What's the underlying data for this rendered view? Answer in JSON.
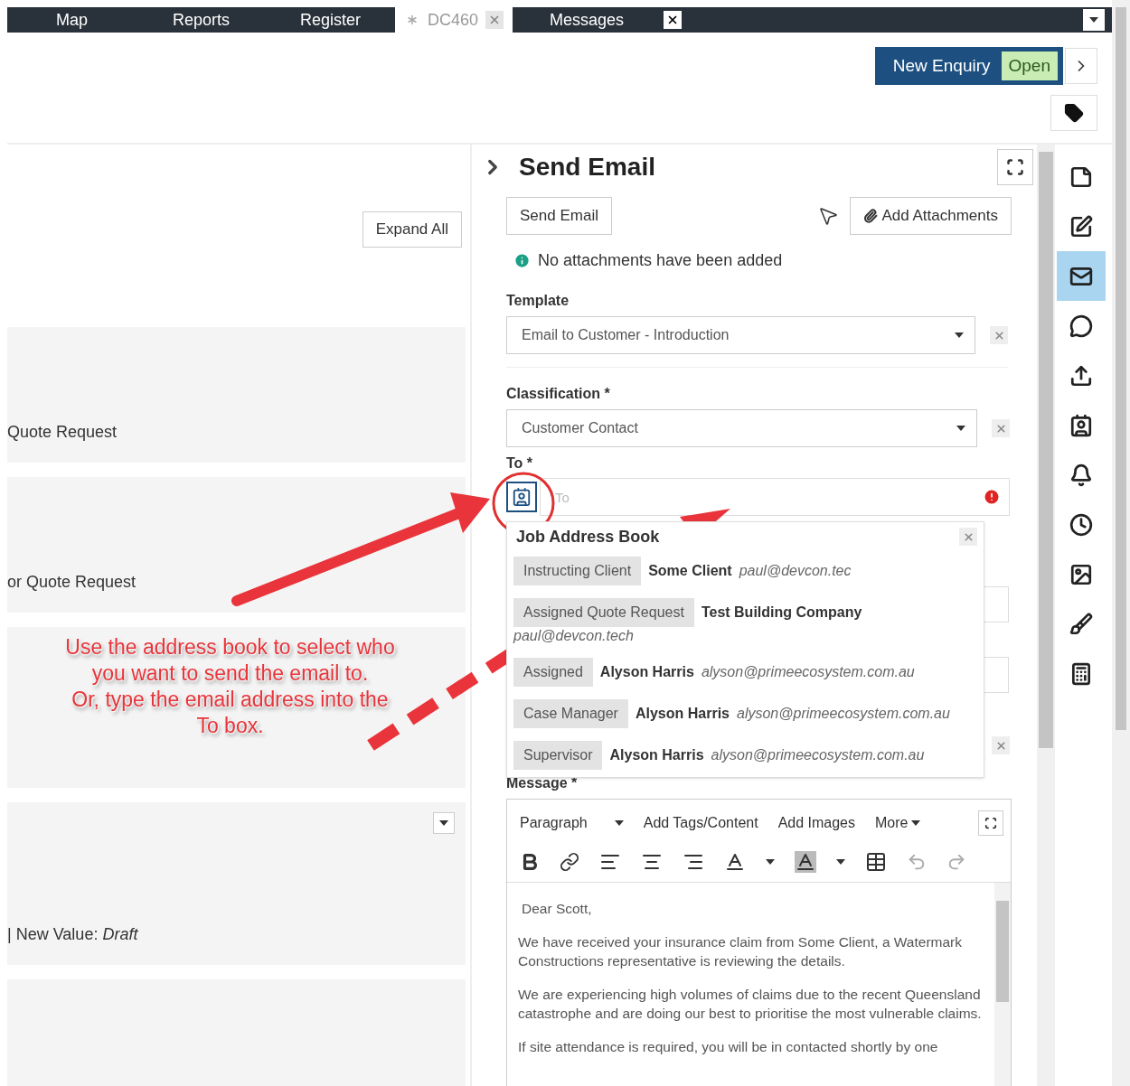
{
  "top_tabs": [
    {
      "label": "Map",
      "selected": false,
      "closable": false
    },
    {
      "label": "Reports",
      "selected": false,
      "closable": false
    },
    {
      "label": "Register",
      "selected": false,
      "closable": false
    },
    {
      "label": "DC460",
      "selected": true,
      "closable": true
    },
    {
      "label": "Messages",
      "selected": false,
      "closable": true
    }
  ],
  "header": {
    "enquiry_button": "New Enquiry",
    "status_badge": "Open"
  },
  "left_panel": {
    "expand_button": "Expand All",
    "cards": [
      {
        "text": "Quote Request",
        "has_menu": false
      },
      {
        "text": "or Quote Request",
        "has_menu": false
      },
      {
        "has_menu": false,
        "annotation": [
          "Use the address book to select who",
          "you want to send the email to.",
          "Or, type the email address into the",
          "To box."
        ]
      },
      {
        "text": "| New Value: *Draft*",
        "has_menu": true
      },
      {
        "has_menu": false
      }
    ]
  },
  "send_email": {
    "title": "Send Email",
    "send_button": "Send Email",
    "attach_button": "Add Attachments",
    "info": "No attachments have been added",
    "selects": [
      {
        "label": "Template",
        "value": "Email to Customer - Introduction"
      },
      {
        "label": "Classification *",
        "value": "Customer Contact"
      }
    ],
    "to": {
      "label": "To *",
      "placeholder": "To",
      "invalid": true
    },
    "address_book": {
      "title": "Job Address Book",
      "entries": [
        {
          "role": "Instructing Client",
          "name": "Some Client",
          "email": "paul@devcon.tec"
        },
        {
          "role": "Assigned Quote Request",
          "name": "Test Building Company",
          "email": "paul@devcon.tech"
        },
        {
          "role": "Assigned",
          "name": "Alyson Harris",
          "email": "alyson@primeecosystem.com.au"
        },
        {
          "role": "Case Manager",
          "name": "Alyson Harris",
          "email": "alyson@primeecosystem.com.au"
        },
        {
          "role": "Supervisor",
          "name": "Alyson Harris",
          "email": "alyson@primeecosystem.com.au"
        }
      ]
    },
    "message": {
      "label": "Message *",
      "format": "Paragraph",
      "menus": [
        "Add Tags/Content",
        "Add Images",
        "More"
      ],
      "paragraphs": [
        "Dear Scott,",
        "We have received your insurance claim from Some Client, a Watermark Constructions representative is reviewing the details.",
        "We are experiencing high volumes of claims due to the recent Queensland catastrophe and are doing our best to prioritise the most vulnerable claims.",
        "If site attendance is required, you will be in contacted shortly by one"
      ]
    }
  },
  "sidebar": [
    {
      "kind": "note",
      "selected": false
    },
    {
      "kind": "edit",
      "selected": false
    },
    {
      "kind": "email",
      "selected": true
    },
    {
      "kind": "sms",
      "selected": false
    },
    {
      "kind": "upload",
      "selected": false
    },
    {
      "kind": "contact",
      "selected": false
    },
    {
      "kind": "bell",
      "selected": false
    },
    {
      "kind": "clock",
      "selected": false
    },
    {
      "kind": "image",
      "selected": false
    },
    {
      "kind": "brush",
      "selected": false
    },
    {
      "kind": "calculator",
      "selected": false
    }
  ]
}
